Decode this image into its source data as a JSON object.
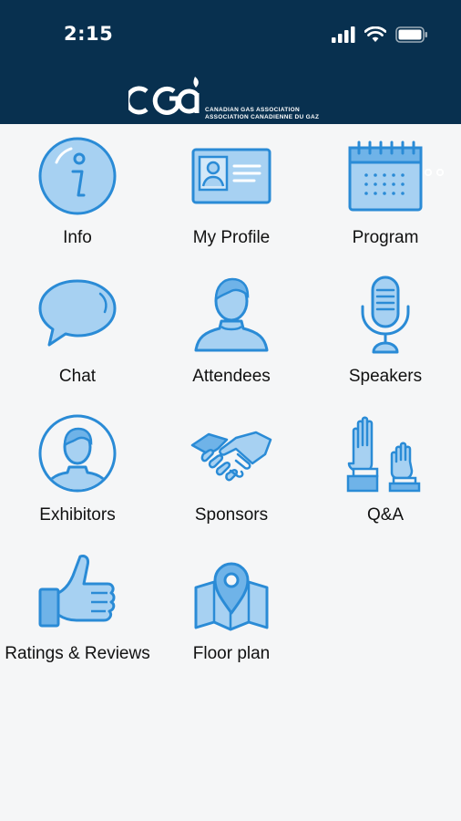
{
  "status_bar": {
    "time": "2:15",
    "icons": [
      "signal-icon",
      "wifi-icon",
      "battery-icon"
    ]
  },
  "header": {
    "logo_text": "CGA",
    "org_name_en": "CANADIAN GAS ASSOCIATION",
    "org_name_fr": "ASSOCIATION CANADIENNE DU GAZ",
    "icons": [
      "bell-icon",
      "more-icon"
    ]
  },
  "colors": {
    "header_bg": "#08304f",
    "icon_fill": "#a7d1f2",
    "icon_stroke": "#2a8bd6",
    "page_bg": "#f5f6f7"
  },
  "menu": [
    {
      "label": "Info",
      "icon": "info-icon"
    },
    {
      "label": "My Profile",
      "icon": "profile-card-icon"
    },
    {
      "label": "Program",
      "icon": "calendar-icon"
    },
    {
      "label": "Chat",
      "icon": "chat-bubble-icon"
    },
    {
      "label": "Attendees",
      "icon": "person-icon"
    },
    {
      "label": "Speakers",
      "icon": "microphone-icon"
    },
    {
      "label": "Exhibitors",
      "icon": "person-circle-icon"
    },
    {
      "label": "Sponsors",
      "icon": "handshake-icon"
    },
    {
      "label": "Q&A",
      "icon": "raised-hands-icon"
    },
    {
      "label": "Ratings & Reviews",
      "icon": "thumbs-up-icon"
    },
    {
      "label": "Floor plan",
      "icon": "map-pin-icon"
    }
  ]
}
